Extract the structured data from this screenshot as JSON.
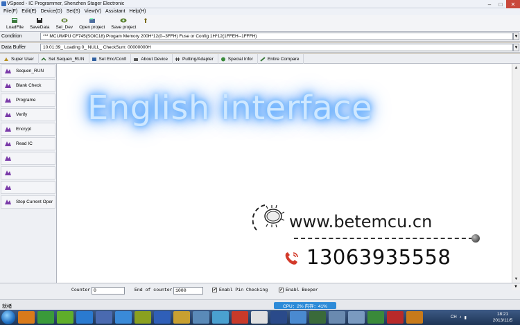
{
  "window": {
    "title": "VSpeed - IC Programmer, Shenzhen Stager Electronic",
    "minimize": "–",
    "maximize": "□",
    "close": "✕"
  },
  "menu": [
    "File(F)",
    "Edit(E)",
    "Device(D)",
    "Set(S)",
    "View(V)",
    "Assistant",
    "Help(H)"
  ],
  "toolbar": [
    {
      "label": "LoadFile",
      "icon": "load-file-icon"
    },
    {
      "label": "SaveData",
      "icon": "save-icon"
    },
    {
      "label": "Sel_Dev",
      "icon": "chip-icon"
    },
    {
      "label": "Open project",
      "icon": "open-project-icon"
    },
    {
      "label": "Save project",
      "icon": "save-project-icon"
    },
    {
      "label": "",
      "icon": "help-icon"
    }
  ],
  "condition": {
    "label": "Condition",
    "value": "***    MCU/MPU  CF745(SOIC18)  Progam Memory 200H*12(0--3FFH)  Fuse or Config 1H*12(1FFEH--1FFFH)"
  },
  "data_buffer": {
    "label": "Data Buffer",
    "value": "10:01:39_ Loading 0_ NULL_  CheckSum: 00000000H"
  },
  "tabs": [
    "Super User",
    "Set Sequen_RUN",
    "Set Enc/Confi",
    "About Device",
    "Putting/Adapter",
    "Special Infor",
    "Entire Compare"
  ],
  "sidebar": [
    "Sequen_RUN",
    "Blank Check",
    "Programe",
    "Verify",
    "Encrypt",
    "Read IC",
    "",
    "",
    "",
    "Stop Current Oper"
  ],
  "overlay": {
    "headline": "English interface",
    "url": "www.betemcu.cn",
    "phone": "13063935558"
  },
  "bottom": {
    "counter_label": "Counter",
    "counter_value": "0",
    "end_label": "End of counter",
    "end_value": "1000",
    "pin_check_label": "Enabl Pin Checking",
    "pin_check_checked": "✔",
    "beeper_label": "Enabl Beeper",
    "beeper_checked": "✔"
  },
  "status": {
    "text": "就绪",
    "cpu": "CPU：2%   内存：41%"
  },
  "taskbar": {
    "tray_lang": "CH",
    "time": "18:21",
    "date": "2013/11/5"
  }
}
